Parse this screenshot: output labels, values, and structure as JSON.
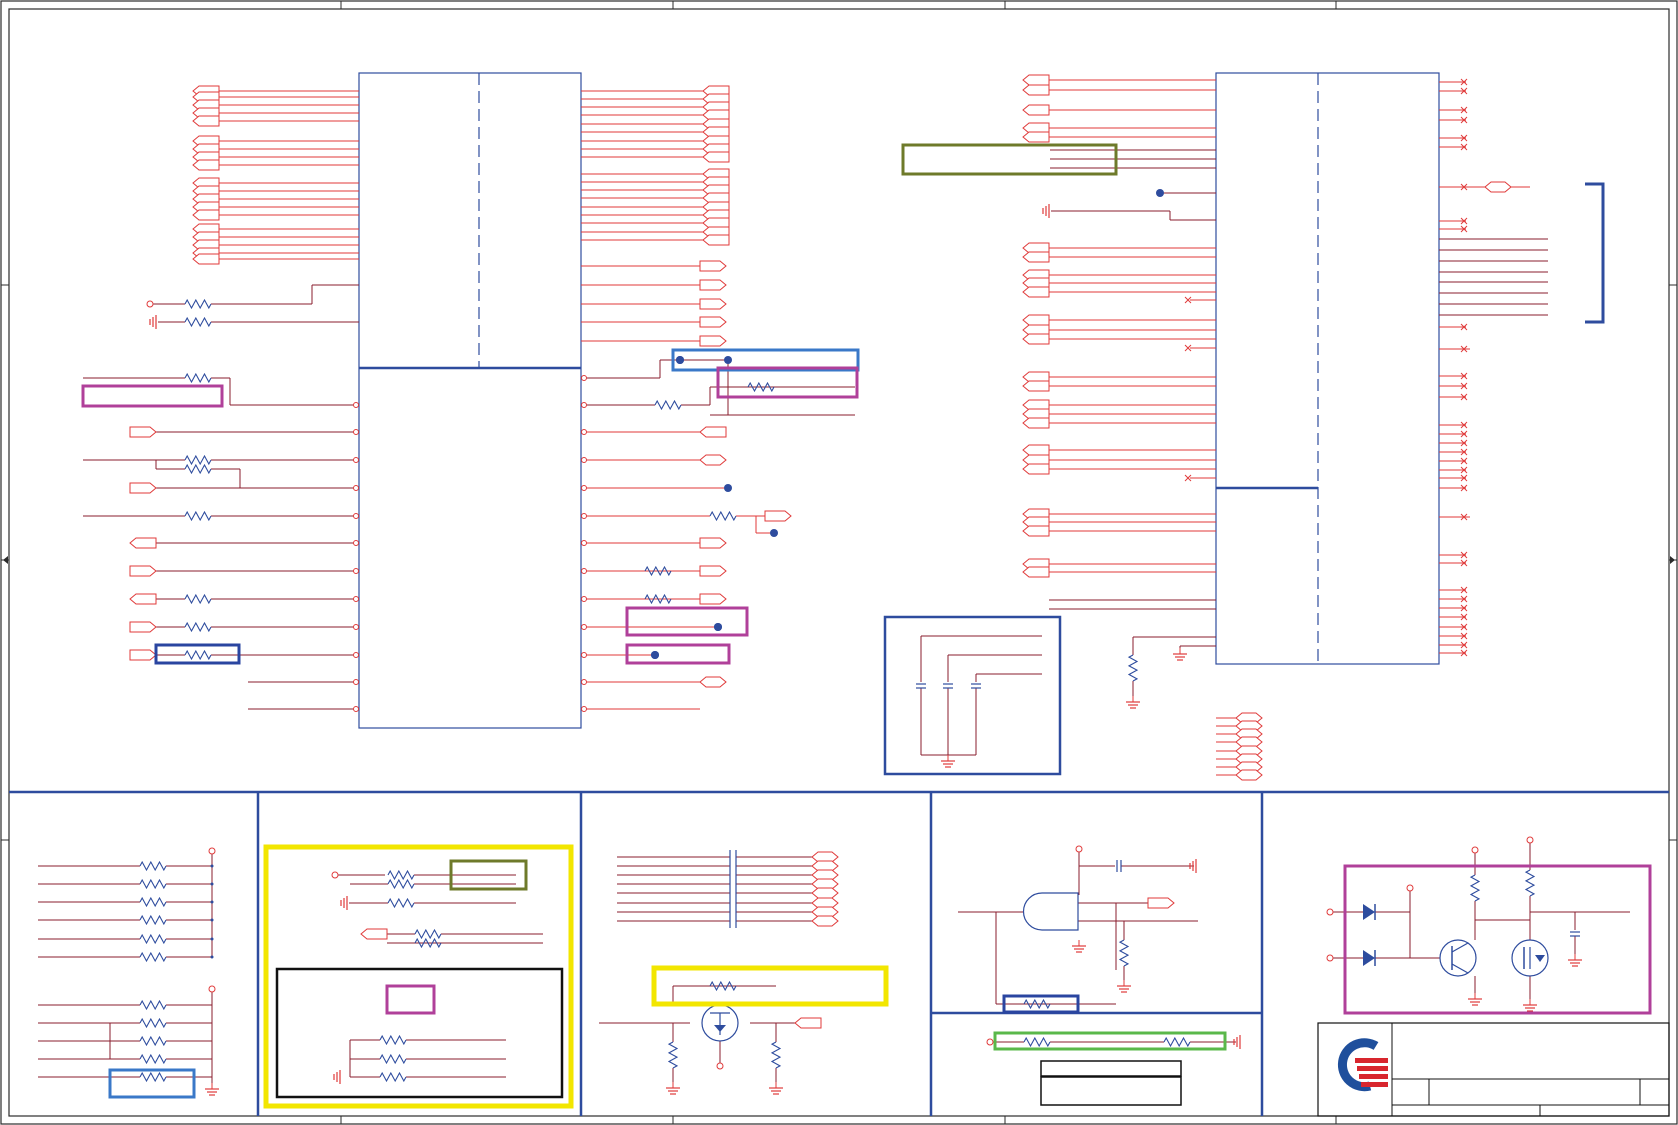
{
  "sheet": {
    "background": "#ffffff",
    "colors": {
      "frame": "#2b2b2b",
      "block": "#2e4c9e",
      "net": "#e03a3a",
      "wire": "#8a1c2e",
      "resistor": "#2e4c9e",
      "junction": "#2e4c9e",
      "highlight_yellow": "#f2e600",
      "highlight_magenta": "#b0409a",
      "highlight_olive": "#6e7a2a",
      "highlight_blue": "#3a78c8",
      "highlight_navy": "#2a45a0",
      "highlight_green": "#5ab84a",
      "logo_blue": "#1f4f9c",
      "logo_red": "#d8262e"
    },
    "icons": {
      "logo": "company-logo-icon",
      "ground": "ground-icon",
      "power": "power-rail-icon",
      "resistor": "resistor-icon",
      "capacitor": "capacitor-icon",
      "mosfet": "mosfet-icon",
      "transistor": "transistor-icon",
      "diode": "diode-icon",
      "and_gate": "and-gate-icon",
      "net_flag": "net-flag-icon"
    }
  }
}
